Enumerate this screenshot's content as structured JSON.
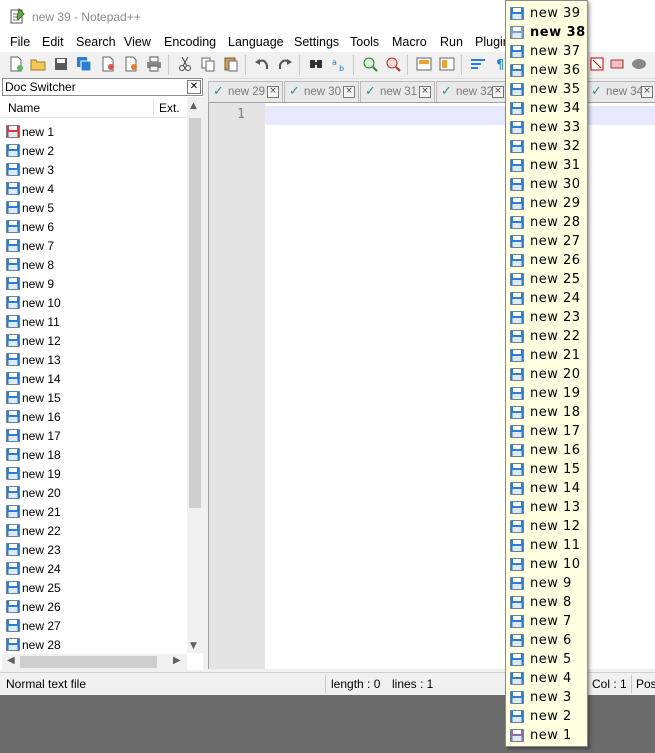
{
  "window": {
    "title": "new 39 - Notepad++"
  },
  "menu": [
    "File",
    "Edit",
    "Search",
    "View",
    "Encoding",
    "Language",
    "Settings",
    "Tools",
    "Macro",
    "Run",
    "Plugin"
  ],
  "doc_switcher": {
    "title": "Doc Switcher",
    "close_glyph": "✕",
    "col_name": "Name",
    "col_ext": "Ext.",
    "items": [
      "new 1",
      "new 2",
      "new 3",
      "new 4",
      "new 5",
      "new 6",
      "new 7",
      "new 8",
      "new 9",
      "new 10",
      "new 11",
      "new 12",
      "new 13",
      "new 14",
      "new 15",
      "new 16",
      "new 17",
      "new 18",
      "new 19",
      "new 20",
      "new 21",
      "new 22",
      "new 23",
      "new 24",
      "new 25",
      "new 26",
      "new 27",
      "new 28"
    ]
  },
  "tabs": [
    "new 29",
    "new 30",
    "new 31",
    "new 32",
    "new 34"
  ],
  "editor": {
    "line_number": "1"
  },
  "status": {
    "file_type": "Normal text file",
    "length": "length : 0",
    "lines": "lines : 1",
    "col": "Col : 1",
    "pos": "Pos"
  },
  "window_list": {
    "current": "new 38",
    "items": [
      "new 39",
      "new 38",
      "new 37",
      "new 36",
      "new 35",
      "new 34",
      "new 33",
      "new 32",
      "new 31",
      "new 30",
      "new 29",
      "new 28",
      "new 27",
      "new 26",
      "new 25",
      "new 24",
      "new 23",
      "new 22",
      "new 21",
      "new 20",
      "new 19",
      "new 18",
      "new 17",
      "new 16",
      "new 15",
      "new 14",
      "new 13",
      "new 12",
      "new 11",
      "new 10",
      "new 9",
      "new 8",
      "new 7",
      "new 6",
      "new 5",
      "new 4",
      "new 3",
      "new 2",
      "new 1"
    ]
  },
  "colors": {
    "popup_bg": "#ffffe1",
    "current_line": "#e8e8ff",
    "saved_icon": "#2a7fd4",
    "modified_icon": "#d8393b"
  }
}
